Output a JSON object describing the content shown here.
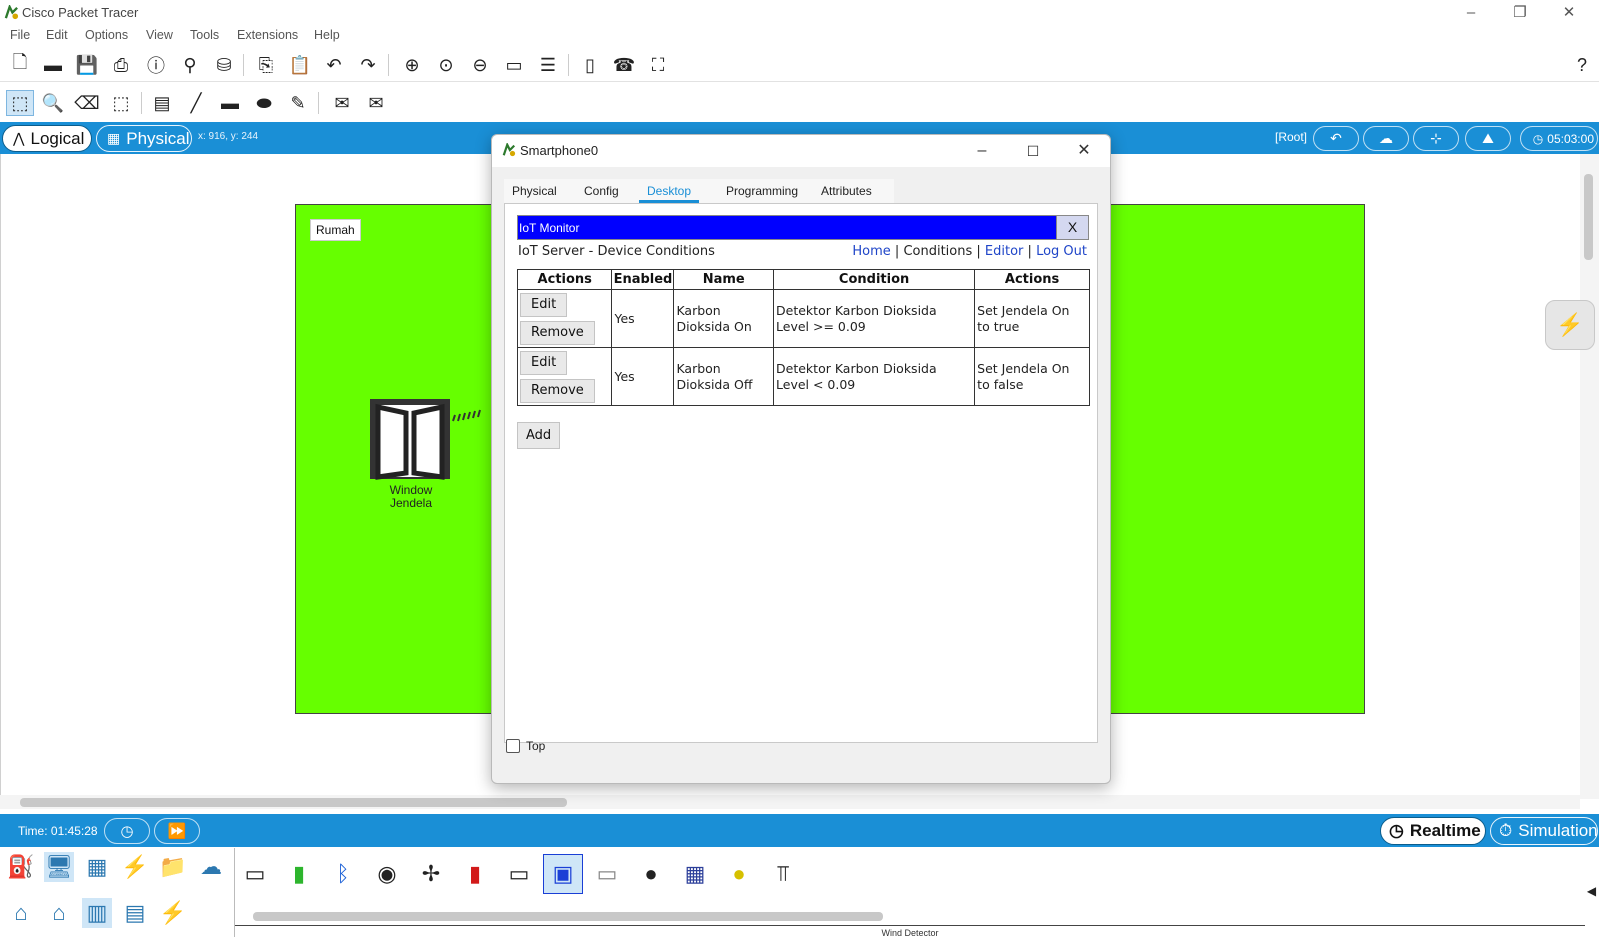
{
  "app": {
    "title": "Cisco Packet Tracer",
    "icon": "packet-tracer-icon",
    "window_controls": [
      "minimize-icon",
      "restore-icon",
      "close-icon"
    ]
  },
  "menu": [
    "File",
    "Edit",
    "Options",
    "View",
    "Tools",
    "Extensions",
    "Help"
  ],
  "toolbar1": {
    "icons": [
      "new-file-icon",
      "open-folder-icon",
      "save-icon",
      "print-icon",
      "info-icon",
      "network-wizard-icon",
      "custom-device-icon",
      "copy-icon",
      "paste-icon",
      "undo-icon",
      "redo-icon",
      "zoom-in-icon",
      "zoom-reset-icon",
      "zoom-out-icon",
      "drawing-palette-icon",
      "custom-devices-dialog-icon",
      "document-icon",
      "ip-phone-icon",
      "screenshot-icon"
    ],
    "help": "?"
  },
  "toolbar2": {
    "icons": [
      "select-icon",
      "inspect-icon",
      "delete-icon",
      "resize-icon",
      "note-icon",
      "line-icon",
      "rectangle-icon",
      "ellipse-icon",
      "freeform-icon",
      "simple-pdu-icon",
      "complex-pdu-icon"
    ]
  },
  "modebar": {
    "logical": "Logical",
    "physical": "Physical",
    "coords": "x: 916, y: 244",
    "root": "[Root]",
    "clock": "05:03:00",
    "pill_icons": [
      "back-arrow-icon",
      "cloud-add-icon",
      "viewport-icon",
      "environment-icon",
      "clock-icon"
    ]
  },
  "workspace": {
    "cluster_label": "Rumah",
    "device_label_line1": "Window",
    "device_label_line2": "Jendela",
    "device_icon": "window-device-icon",
    "background_color": "#66ff00"
  },
  "timebar": {
    "time": "Time: 01:45:28",
    "realtime": "Realtime",
    "simulation": "Simulation",
    "icons": [
      "reset-clock-icon",
      "fast-forward-icon"
    ]
  },
  "device_panel": {
    "category_icons": [
      "network-devices-icon",
      "end-devices-icon",
      "components-icon",
      "connections-icon",
      "misc-icon",
      "multiuser-icon",
      "home-icon",
      "city-icon",
      "industrial-icon",
      "power-grid-icon",
      "building-icon"
    ],
    "device_icons": [
      "appliance-icon",
      "battery-icon",
      "bluetooth-speaker-icon",
      "carbon-dioxide-detector-icon",
      "ceiling-fan-icon",
      "fire-sprinkler-icon",
      "display-icon",
      "tablet-icon",
      "garage-door-icon",
      "speaker-icon",
      "solar-panel-icon",
      "street-lamp-icon",
      "wind-detector-icon"
    ],
    "caption": "Wind Detector"
  },
  "dialog": {
    "title": "Smartphone0",
    "tabs": [
      "Physical",
      "Config",
      "Desktop",
      "Programming",
      "Attributes"
    ],
    "active_tab": "Desktop",
    "iot_header": "IoT Monitor",
    "iot_close": "X",
    "server_title": "IoT Server - Device Conditions",
    "nav": {
      "home": "Home",
      "conditions": "Conditions",
      "editor": "Editor",
      "logout": "Log Out",
      "sep": "|"
    },
    "table": {
      "headers": [
        "Actions",
        "Enabled",
        "Name",
        "Condition",
        "Actions"
      ],
      "rows": [
        {
          "edit": "Edit",
          "remove": "Remove",
          "enabled": "Yes",
          "name_l1": "Karbon",
          "name_l2": "Dioksida On",
          "cond_l1": "Detektor Karbon Dioksida",
          "cond_l2": "Level >= 0.09",
          "act_l1": "Set Jendela On",
          "act_l2": "to true"
        },
        {
          "edit": "Edit",
          "remove": "Remove",
          "enabled": "Yes",
          "name_l1": "Karbon",
          "name_l2": "Dioksida Off",
          "cond_l1": "Detektor Karbon Dioksida",
          "cond_l2": "Level < 0.09",
          "act_l1": "Set Jendela On",
          "act_l2": "to false"
        }
      ]
    },
    "add": "Add",
    "top_label": "Top"
  }
}
